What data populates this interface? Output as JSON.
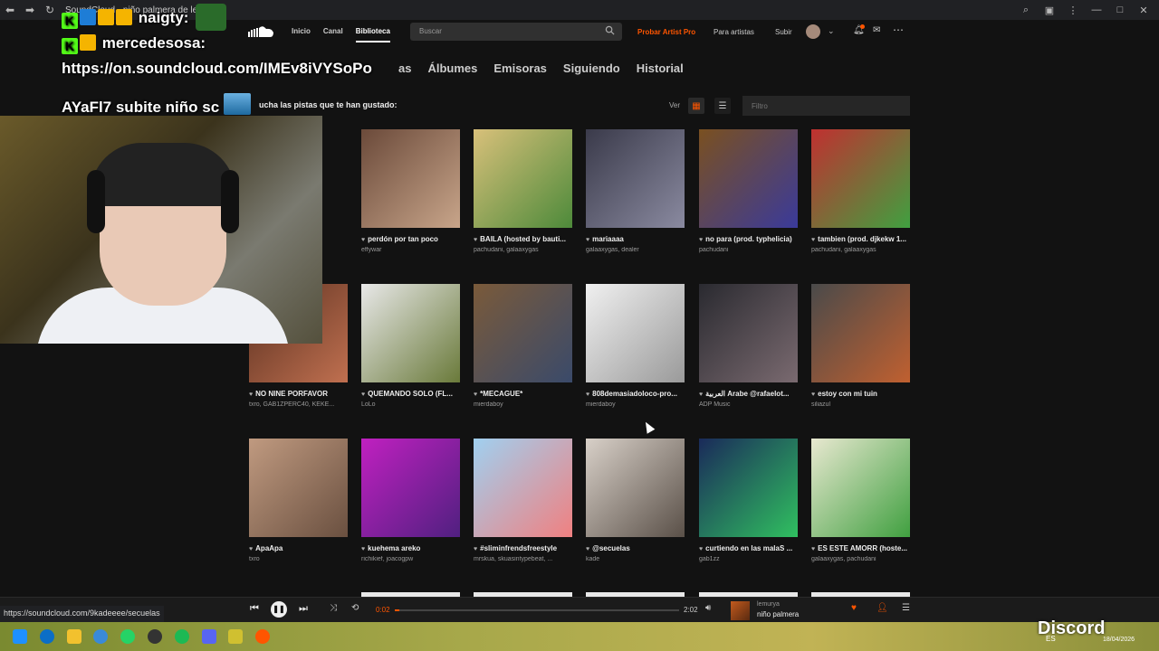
{
  "browser": {
    "tab_title": "SoundCloud - niño palmera de lemu...",
    "status_url": "https://soundcloud.com/9kadeeee/secuelas"
  },
  "header": {
    "nav": [
      "Inicio",
      "Canal",
      "Biblioteca"
    ],
    "search_placeholder": "Buscar",
    "pro_label": "Probar Artist Pro",
    "artists_label": "Para artistas",
    "upload_label": "Subir"
  },
  "library": {
    "tabs": [
      "as",
      "Álbumes",
      "Emisoras",
      "Siguiendo",
      "Historial"
    ],
    "intro": "ucha las pistas que te han gustado:",
    "view_label": "Ver",
    "filter_placeholder": "Filtro"
  },
  "tracks": [
    {
      "title": "perdón por tan poco",
      "user": "effywar",
      "colors": [
        "#6b4a3a",
        "#c8a58a"
      ]
    },
    {
      "title": "BAILA (hosted by bauti...",
      "user": "pachudani, galaaxygas",
      "colors": [
        "#d8c07a",
        "#4d8a3a"
      ]
    },
    {
      "title": "mariaaaa",
      "user": "galaaxygas, dealer",
      "colors": [
        "#3a3a4a",
        "#8a8aa0"
      ]
    },
    {
      "title": "no para (prod. typhelicia)",
      "user": "pachudani",
      "colors": [
        "#7a5020",
        "#3a3a9a"
      ]
    },
    {
      "title": "tambien (prod. djkekw 1...",
      "user": "pachudani, galaaxygas",
      "colors": [
        "#c03030",
        "#40a040"
      ]
    },
    {
      "title": "NO NINE PORFAVOR",
      "user": "txro, GAB1ZPERC40, KEKE...",
      "colors": [
        "#5a3020",
        "#c07050"
      ]
    },
    {
      "title": "QUEMANDO SOLO (FL...",
      "user": "LoLo",
      "colors": [
        "#e8e8e8",
        "#6a7a3a"
      ]
    },
    {
      "title": "*MECAGUE*",
      "user": "mierdaboy",
      "colors": [
        "#7a5a3a",
        "#3a4a6a"
      ]
    },
    {
      "title": "808demasiadoloco-pro...",
      "user": "mierdaboy",
      "colors": [
        "#f0f0f0",
        "#9a9a9a"
      ]
    },
    {
      "title": "العربية Arabe @rafaelot...",
      "user": "ADP Music",
      "colors": [
        "#2a2a30",
        "#7a6a70"
      ]
    },
    {
      "title": "estoy con mi tuin",
      "user": "siliazul",
      "colors": [
        "#4a4a4a",
        "#c06030"
      ]
    },
    {
      "title": "ApaApa",
      "user": "txro",
      "colors": [
        "#c09a80",
        "#6a5040"
      ]
    },
    {
      "title": "kuehema areko",
      "user": "richikief, joacogpw",
      "colors": [
        "#c020c0",
        "#502080"
      ]
    },
    {
      "title": "#sliminfrendsfreestyle",
      "user": "mrskua, skuasintypebeat, ...",
      "colors": [
        "#a0d0f0",
        "#f08080"
      ]
    },
    {
      "title": "@secuelas",
      "user": "kade",
      "colors": [
        "#d8d0c8",
        "#5a5048"
      ]
    },
    {
      "title": "curtiendo en las malaS ...",
      "user": "gab1zz",
      "colors": [
        "#1a2a5a",
        "#30c060"
      ]
    },
    {
      "title": "ES ESTE AMORR (hoste...",
      "user": "galaaxygas, pachudani",
      "colors": [
        "#e8e8d0",
        "#40a040"
      ]
    }
  ],
  "overlay": {
    "line1_user": "naigty:",
    "line2_user": "mercedesosa:",
    "line3": "https://on.soundcloud.com/IMEv8iVYSoPo",
    "line4": "AYaFl7 subite niño sc"
  },
  "player": {
    "current_time": "0:02",
    "duration": "2:02",
    "progress": 0.016,
    "artist": "lemurya",
    "title": "niño palmera"
  },
  "taskbar": {
    "lang": "ES",
    "time": "",
    "date": "18/04/2026",
    "watermark": "Discord"
  },
  "colors": {
    "accent": "#ff5500",
    "bg": "#121212"
  }
}
